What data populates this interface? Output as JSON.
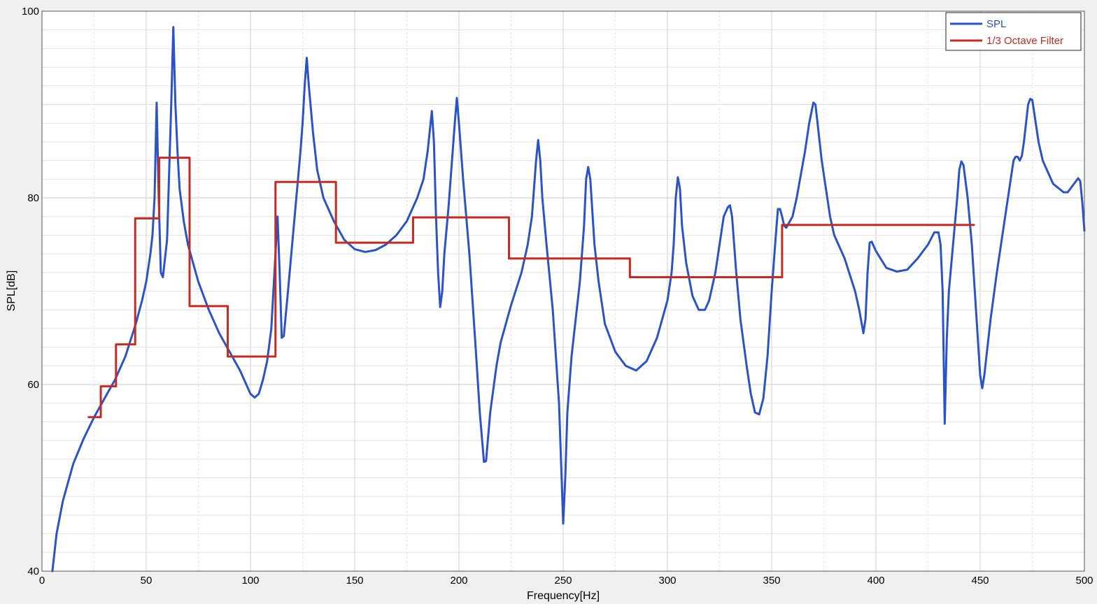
{
  "chart_data": {
    "type": "line",
    "title": "",
    "xlabel": "Frequency[Hz]",
    "ylabel": "SPL[dB]",
    "xlim": [
      0,
      500
    ],
    "ylim": [
      40,
      100
    ],
    "x_major_ticks": [
      0,
      50,
      100,
      150,
      200,
      250,
      300,
      350,
      400,
      450,
      500
    ],
    "x_minor_step": 25,
    "y_major_ticks": [
      40,
      60,
      80,
      100
    ],
    "y_minor_step": 2,
    "grid": true,
    "legend_position": "top-right",
    "series": [
      {
        "name": "SPL",
        "color": "#2a52c9",
        "style": "line",
        "points": [
          [
            5,
            40
          ],
          [
            7,
            44
          ],
          [
            10,
            47.5
          ],
          [
            15,
            51.5
          ],
          [
            20,
            54.2
          ],
          [
            25,
            56.5
          ],
          [
            30,
            58.5
          ],
          [
            35,
            60.5
          ],
          [
            40,
            63
          ],
          [
            45,
            66.5
          ],
          [
            48,
            69
          ],
          [
            50,
            71
          ],
          [
            52,
            74
          ],
          [
            53,
            76
          ],
          [
            54,
            80
          ],
          [
            55,
            90.2
          ],
          [
            56,
            80
          ],
          [
            57,
            72
          ],
          [
            58,
            71.5
          ],
          [
            60,
            75.5
          ],
          [
            62,
            90
          ],
          [
            63,
            98.3
          ],
          [
            64,
            90
          ],
          [
            65,
            85
          ],
          [
            66,
            81
          ],
          [
            68,
            77.5
          ],
          [
            70,
            75
          ],
          [
            75,
            71
          ],
          [
            80,
            68
          ],
          [
            85,
            65.5
          ],
          [
            90,
            63.5
          ],
          [
            95,
            61.5
          ],
          [
            100,
            59
          ],
          [
            102,
            58.6
          ],
          [
            104,
            59
          ],
          [
            106,
            60.5
          ],
          [
            108,
            62.5
          ],
          [
            110,
            66
          ],
          [
            111,
            70
          ],
          [
            112,
            74
          ],
          [
            113,
            78
          ],
          [
            114,
            72
          ],
          [
            115,
            65
          ],
          [
            116,
            65.2
          ],
          [
            118,
            70
          ],
          [
            120,
            75
          ],
          [
            122,
            80
          ],
          [
            124,
            85
          ],
          [
            125,
            88
          ],
          [
            126,
            92
          ],
          [
            127,
            95
          ],
          [
            128,
            92
          ],
          [
            130,
            87
          ],
          [
            132,
            83
          ],
          [
            135,
            80
          ],
          [
            140,
            77.5
          ],
          [
            145,
            75.5
          ],
          [
            150,
            74.5
          ],
          [
            155,
            74.2
          ],
          [
            160,
            74.4
          ],
          [
            165,
            75
          ],
          [
            170,
            76
          ],
          [
            175,
            77.5
          ],
          [
            180,
            80
          ],
          [
            183,
            82
          ],
          [
            185,
            85
          ],
          [
            187,
            89.3
          ],
          [
            188,
            86
          ],
          [
            189,
            78
          ],
          [
            190,
            72
          ],
          [
            191,
            68.3
          ],
          [
            192,
            70
          ],
          [
            193,
            74
          ],
          [
            195,
            79
          ],
          [
            197,
            85
          ],
          [
            198,
            88
          ],
          [
            199,
            90.7
          ],
          [
            200,
            88
          ],
          [
            202,
            82
          ],
          [
            205,
            74
          ],
          [
            208,
            64
          ],
          [
            210,
            57
          ],
          [
            212,
            51.7
          ],
          [
            213,
            51.8
          ],
          [
            215,
            57
          ],
          [
            218,
            62
          ],
          [
            220,
            64.5
          ],
          [
            225,
            68.5
          ],
          [
            230,
            72
          ],
          [
            233,
            75
          ],
          [
            235,
            78
          ],
          [
            237,
            84
          ],
          [
            238,
            86.2
          ],
          [
            239,
            84
          ],
          [
            240,
            80
          ],
          [
            242,
            75
          ],
          [
            245,
            68
          ],
          [
            248,
            58
          ],
          [
            250,
            45.1
          ],
          [
            251,
            50
          ],
          [
            252,
            57
          ],
          [
            254,
            63
          ],
          [
            256,
            67
          ],
          [
            258,
            71
          ],
          [
            260,
            77
          ],
          [
            261,
            82
          ],
          [
            262,
            83.3
          ],
          [
            263,
            82
          ],
          [
            265,
            75
          ],
          [
            267,
            71
          ],
          [
            270,
            66.5
          ],
          [
            275,
            63.5
          ],
          [
            280,
            62
          ],
          [
            285,
            61.5
          ],
          [
            290,
            62.5
          ],
          [
            295,
            65
          ],
          [
            300,
            69
          ],
          [
            302,
            72
          ],
          [
            303,
            75
          ],
          [
            304,
            80
          ],
          [
            305,
            82.2
          ],
          [
            306,
            81
          ],
          [
            307,
            77
          ],
          [
            309,
            73
          ],
          [
            312,
            69.5
          ],
          [
            315,
            68
          ],
          [
            318,
            68
          ],
          [
            320,
            69
          ],
          [
            323,
            72
          ],
          [
            325,
            75
          ],
          [
            327,
            78
          ],
          [
            329,
            79
          ],
          [
            330,
            79.2
          ],
          [
            331,
            78
          ],
          [
            333,
            72
          ],
          [
            335,
            67
          ],
          [
            338,
            62
          ],
          [
            340,
            59
          ],
          [
            342,
            57
          ],
          [
            344,
            56.8
          ],
          [
            346,
            58.5
          ],
          [
            348,
            63
          ],
          [
            350,
            70
          ],
          [
            352,
            76
          ],
          [
            353,
            78.8
          ],
          [
            354,
            78.8
          ],
          [
            355,
            78
          ],
          [
            356,
            77
          ],
          [
            357,
            76.8
          ],
          [
            358,
            77.2
          ],
          [
            360,
            78
          ],
          [
            362,
            80
          ],
          [
            364,
            82.5
          ],
          [
            366,
            85
          ],
          [
            368,
            88
          ],
          [
            370,
            90.2
          ],
          [
            371,
            90
          ],
          [
            372,
            88
          ],
          [
            374,
            84
          ],
          [
            376,
            81
          ],
          [
            378,
            78
          ],
          [
            380,
            76
          ],
          [
            385,
            73.5
          ],
          [
            390,
            70
          ],
          [
            392,
            68
          ],
          [
            394,
            65.5
          ],
          [
            395,
            67
          ],
          [
            396,
            72
          ],
          [
            397,
            75.2
          ],
          [
            398,
            75.3
          ],
          [
            400,
            74.3
          ],
          [
            405,
            72.5
          ],
          [
            410,
            72.1
          ],
          [
            415,
            72.3
          ],
          [
            420,
            73.5
          ],
          [
            425,
            75
          ],
          [
            428,
            76.3
          ],
          [
            430,
            76.3
          ],
          [
            431,
            75
          ],
          [
            432,
            70
          ],
          [
            433,
            55.8
          ],
          [
            434,
            65
          ],
          [
            435,
            70
          ],
          [
            437,
            75
          ],
          [
            439,
            80
          ],
          [
            440,
            83
          ],
          [
            441,
            83.9
          ],
          [
            442,
            83.5
          ],
          [
            444,
            80
          ],
          [
            446,
            75
          ],
          [
            448,
            68
          ],
          [
            450,
            61
          ],
          [
            451,
            59.6
          ],
          [
            452,
            61
          ],
          [
            455,
            67
          ],
          [
            458,
            72
          ],
          [
            460,
            75
          ],
          [
            462,
            78
          ],
          [
            464,
            81
          ],
          [
            466,
            84
          ],
          [
            467,
            84.4
          ],
          [
            468,
            84.4
          ],
          [
            469,
            84
          ],
          [
            470,
            84.5
          ],
          [
            471,
            86
          ],
          [
            472,
            88
          ],
          [
            473,
            90
          ],
          [
            474,
            90.6
          ],
          [
            475,
            90.5
          ],
          [
            476,
            89
          ],
          [
            478,
            86
          ],
          [
            480,
            84
          ],
          [
            485,
            81.5
          ],
          [
            490,
            80.6
          ],
          [
            492,
            80.6
          ],
          [
            495,
            81.5
          ],
          [
            497,
            82.1
          ],
          [
            498,
            81.8
          ],
          [
            499,
            79.5
          ],
          [
            500,
            76.5
          ]
        ]
      },
      {
        "name": "1/3 Octave Filter",
        "color": "#c82a22",
        "style": "step",
        "points": [
          [
            22.4,
            56.5
          ],
          [
            28.2,
            56.5
          ],
          [
            28.2,
            59.8
          ],
          [
            35.5,
            59.8
          ],
          [
            35.5,
            64.3
          ],
          [
            44.7,
            64.3
          ],
          [
            44.7,
            77.8
          ],
          [
            56.2,
            77.8
          ],
          [
            56.2,
            84.3
          ],
          [
            70.8,
            84.3
          ],
          [
            70.8,
            68.4
          ],
          [
            89.1,
            68.4
          ],
          [
            89.1,
            63
          ],
          [
            112,
            63
          ],
          [
            112,
            81.7
          ],
          [
            141,
            81.7
          ],
          [
            141,
            75.2
          ],
          [
            178,
            75.2
          ],
          [
            178,
            77.9
          ],
          [
            224,
            77.9
          ],
          [
            224,
            73.5
          ],
          [
            282,
            73.5
          ],
          [
            282,
            71.5
          ],
          [
            355,
            71.5
          ],
          [
            355,
            77.1
          ],
          [
            447,
            77.1
          ]
        ]
      }
    ]
  },
  "legend": {
    "spl_label": "SPL",
    "filter_label": "1/3 Octave Filter",
    "spl_color": "#2a52c9",
    "filter_color": "#c82a22"
  }
}
